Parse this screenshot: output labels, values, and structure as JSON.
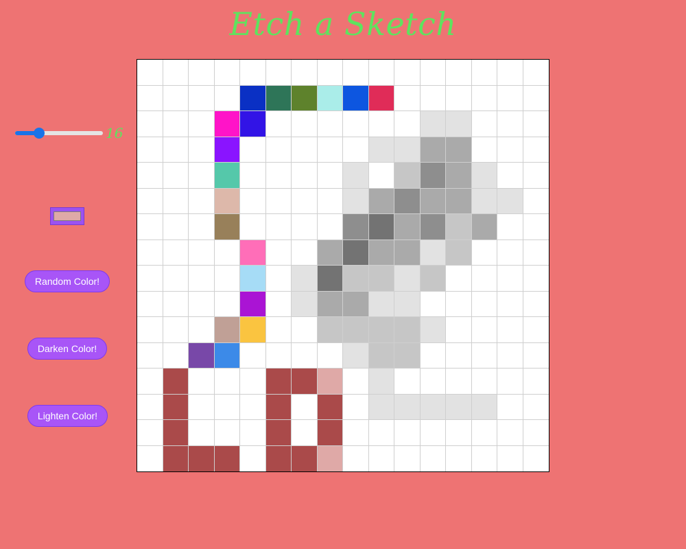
{
  "title": "Etch a Sketch",
  "colors": {
    "background": "#ee7373",
    "title": "#5ee35e",
    "button": "#a855f7",
    "picker_value": "#dfa9a7",
    "slider_accent": "#1a73e8"
  },
  "slider": {
    "min": 1,
    "max": 64,
    "value": 16,
    "value_label": "16"
  },
  "buttons": {
    "random": "Random Color!",
    "darken": "Darken Color!",
    "lighten": "Lighten Color!"
  },
  "grid": {
    "size": 16,
    "cells": {
      "1,4": "#0a30c4",
      "1,5": "#2e7558",
      "1,6": "#5e822c",
      "1,7": "#aaede9",
      "1,8": "#0d56e0",
      "1,9": "#e02c58",
      "2,3": "#ff14c8",
      "2,4": "#3214e6",
      "2,11": "#e2e2e2",
      "2,12": "#e2e2e2",
      "3,3": "#8a14ff",
      "3,9": "#e2e2e2",
      "3,10": "#e2e2e2",
      "3,11": "#aaaaaa",
      "3,12": "#aaaaaa",
      "4,3": "#55c8aa",
      "4,8": "#e2e2e2",
      "4,10": "#c6c6c6",
      "4,11": "#8e8e8e",
      "4,12": "#aaaaaa",
      "4,13": "#e2e2e2",
      "5,3": "#ddb8aa",
      "5,8": "#e2e2e2",
      "5,9": "#aaaaaa",
      "5,10": "#8e8e8e",
      "5,11": "#aaaaaa",
      "5,12": "#aaaaaa",
      "5,13": "#e2e2e2",
      "5,14": "#e2e2e2",
      "6,3": "#98805a",
      "6,8": "#8e8e8e",
      "6,9": "#737373",
      "6,10": "#aaaaaa",
      "6,11": "#8e8e8e",
      "6,12": "#c6c6c6",
      "6,13": "#aaaaaa",
      "7,4": "#ff6eb8",
      "7,7": "#aaaaaa",
      "7,8": "#737373",
      "7,9": "#aaaaaa",
      "7,10": "#aaaaaa",
      "7,11": "#e2e2e2",
      "7,12": "#c6c6c6",
      "8,4": "#a6dcf6",
      "8,6": "#e2e2e2",
      "8,7": "#737373",
      "8,8": "#c6c6c6",
      "8,9": "#c6c6c6",
      "8,10": "#e2e2e2",
      "8,11": "#c6c6c6",
      "9,4": "#aa14d4",
      "9,6": "#e2e2e2",
      "9,7": "#aaaaaa",
      "9,8": "#aaaaaa",
      "9,9": "#e2e2e2",
      "9,10": "#e2e2e2",
      "10,3": "#c0a096",
      "10,4": "#fac440",
      "10,7": "#c6c6c6",
      "10,8": "#c6c6c6",
      "10,9": "#c6c6c6",
      "10,10": "#c6c6c6",
      "10,11": "#e2e2e2",
      "11,2": "#7848a8",
      "11,3": "#3c8ae8",
      "11,8": "#e2e2e2",
      "11,9": "#c6c6c6",
      "11,10": "#c6c6c6",
      "12,1": "#aa4a4a",
      "12,5": "#aa4a4a",
      "12,6": "#aa4a4a",
      "12,7": "#dfa9a7",
      "12,9": "#e2e2e2",
      "13,1": "#aa4a4a",
      "13,5": "#aa4a4a",
      "13,7": "#aa4a4a",
      "13,9": "#e2e2e2",
      "13,10": "#e2e2e2",
      "13,11": "#e2e2e2",
      "13,12": "#e2e2e2",
      "13,13": "#e2e2e2",
      "14,1": "#aa4a4a",
      "14,5": "#aa4a4a",
      "14,7": "#aa4a4a",
      "15,1": "#aa4a4a",
      "15,2": "#aa4a4a",
      "15,3": "#aa4a4a",
      "15,5": "#aa4a4a",
      "15,6": "#aa4a4a",
      "15,7": "#dfa9a7"
    }
  }
}
